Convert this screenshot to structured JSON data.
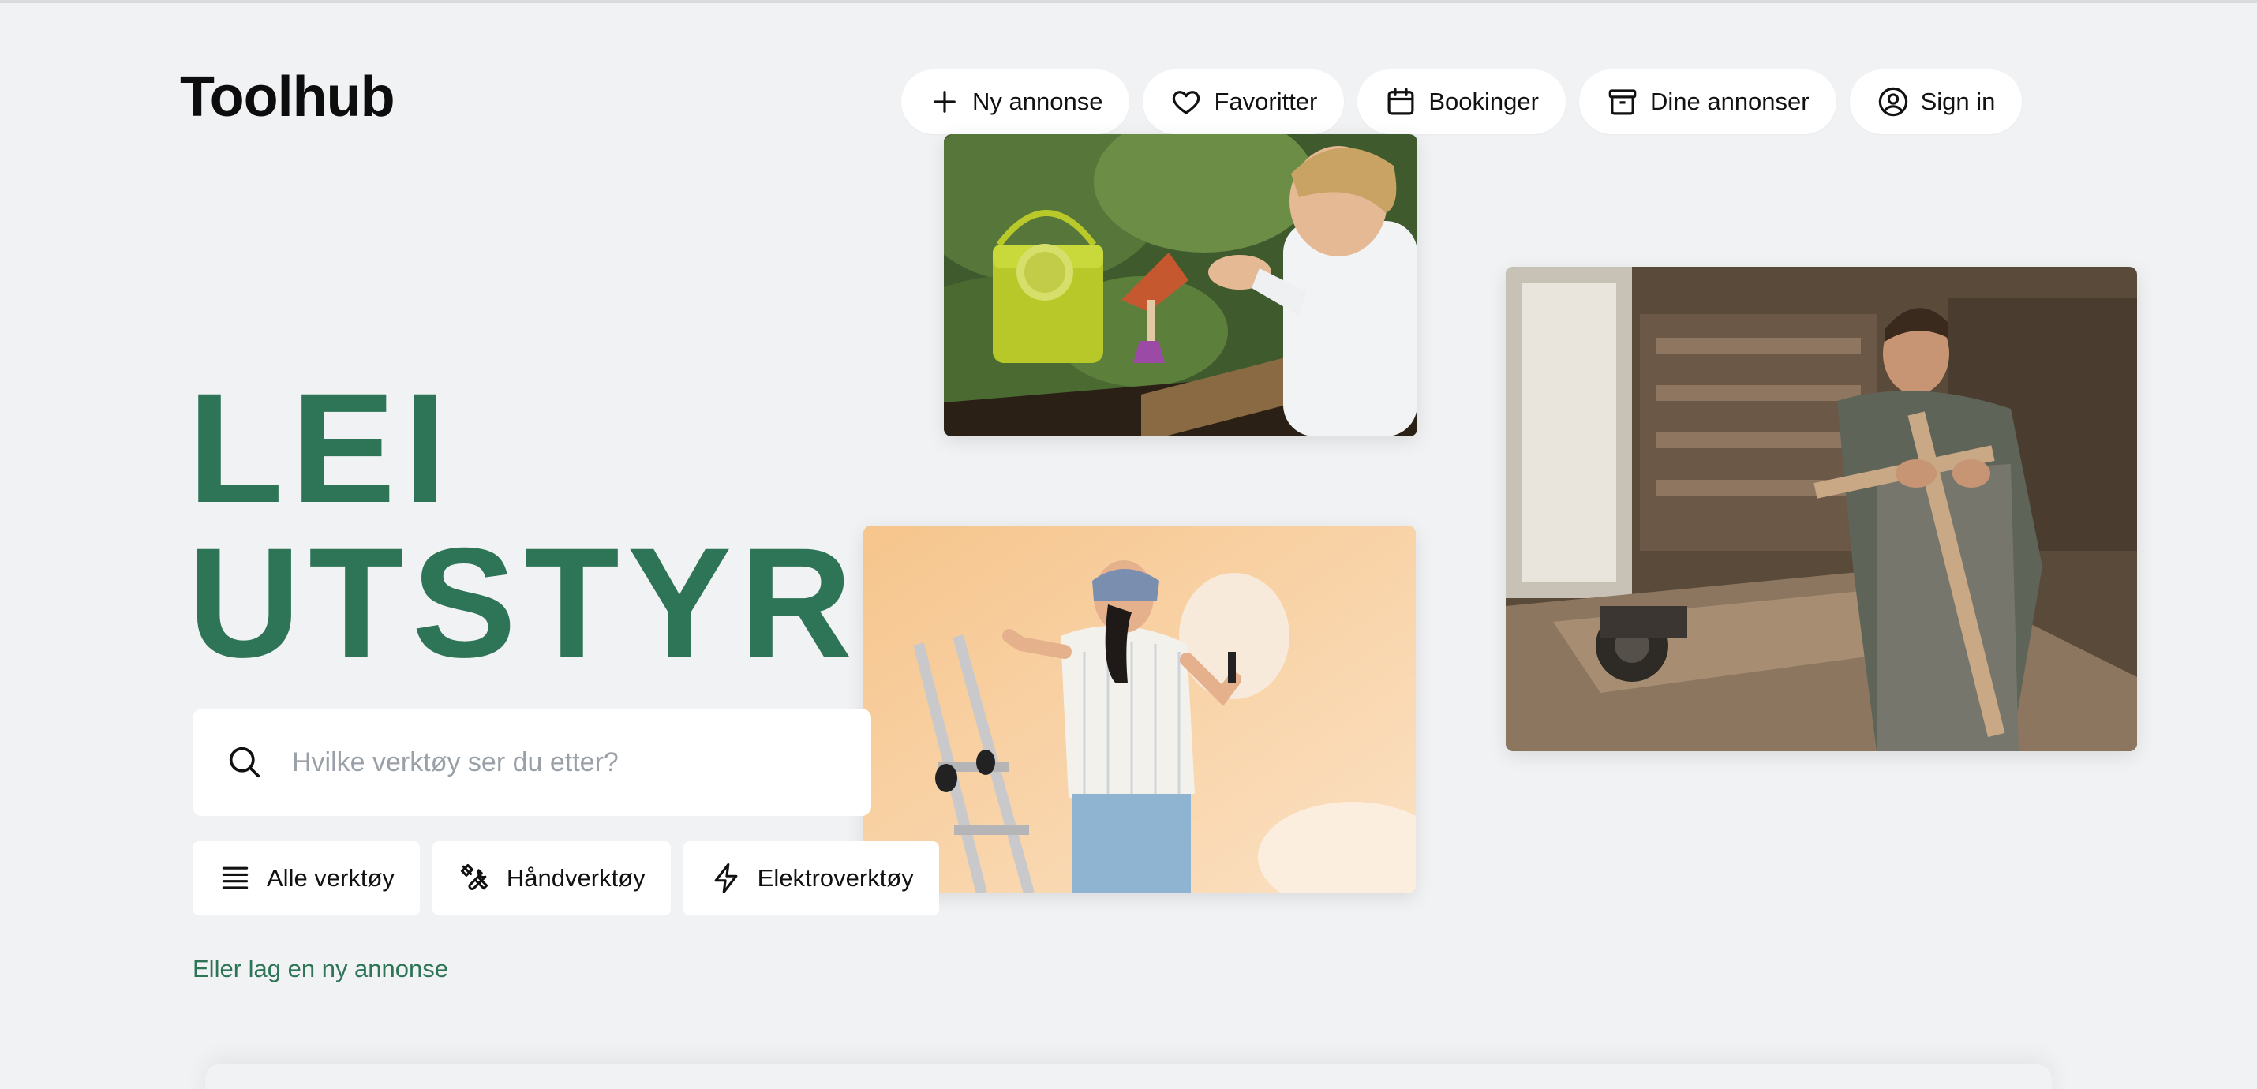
{
  "brand": {
    "logo": "Toolhub"
  },
  "nav": {
    "new_listing": "Ny annonse",
    "favorites": "Favoritter",
    "bookings": "Bookinger",
    "your_listings": "Dine annonser",
    "sign_in": "Sign in"
  },
  "hero": {
    "line1": "LEI",
    "line2": "UTSTYR",
    "accent_color": "#2e7457"
  },
  "search": {
    "placeholder": "Hvilke verktøy ser du etter?"
  },
  "categories": [
    {
      "label": "Alle verktøy",
      "icon": "list-icon"
    },
    {
      "label": "Håndverktøy",
      "icon": "tools-icon"
    },
    {
      "label": "Elektroverktøy",
      "icon": "lightning-icon"
    }
  ],
  "create_link": "Eller lag en ny annonse",
  "images": [
    {
      "name": "child-gardening-photo"
    },
    {
      "name": "woodworker-photo"
    },
    {
      "name": "woman-painting-wall-photo"
    }
  ]
}
